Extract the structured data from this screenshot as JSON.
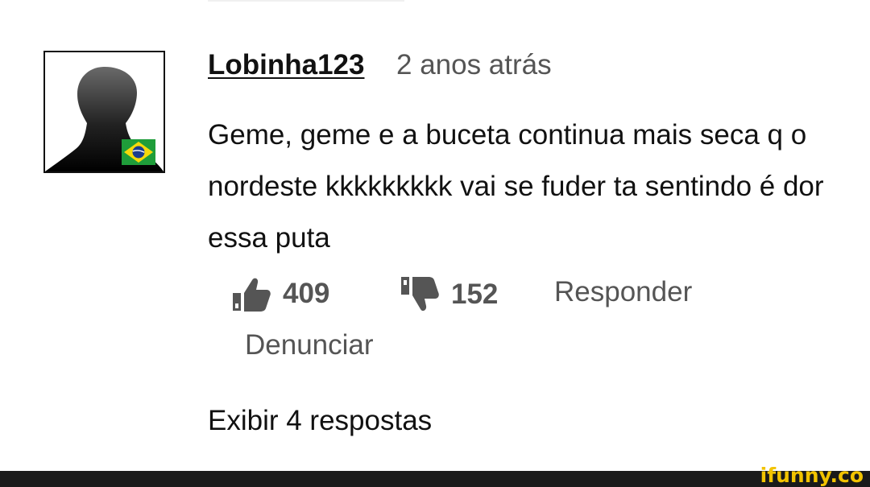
{
  "comment": {
    "username": "Lobinha123",
    "timestamp": "2 anos atrás",
    "text": "Geme, geme e a buceta continua mais seca q o nordeste kkkkkkkkk vai se fuder ta sentindo é dor essa puta",
    "avatar_icon": "default-user-silhouette-icon",
    "flag_icon": "brazil-flag-icon",
    "likes": "409",
    "dislikes": "152",
    "reply_label": "Responder",
    "report_label": "Denunciar",
    "view_replies_label": "Exibir 4 respostas"
  },
  "watermark": "ifunny.co",
  "colors": {
    "text_primary": "#111111",
    "text_secondary": "#555555",
    "footer_bg": "#1a1a1a",
    "watermark": "#f2c300",
    "flag_green": "#1f9d3a",
    "flag_yellow": "#f5d90a",
    "flag_blue": "#1b3c8f"
  }
}
